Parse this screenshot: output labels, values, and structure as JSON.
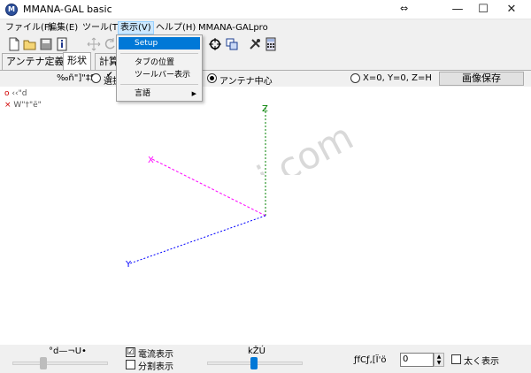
{
  "window": {
    "title": "MMANA-GAL basic",
    "app_icon_glyph": "M",
    "resize_glyph": "⇔",
    "minimize_glyph": "—",
    "maximize_glyph": "☐",
    "close_glyph": "✕"
  },
  "menubar": {
    "file": "ファイル(F)",
    "edit": "編集(E)",
    "tools": "ツール(T)",
    "view": "表示(V)",
    "help": "ヘルプ(H)",
    "pro": "MMANA-GALpro"
  },
  "view_menu": {
    "setup": "Setup",
    "tab_position": "タブの位置",
    "toolbar_show": "ツールバー表示",
    "toolbar_checked": "✔",
    "language": "言語",
    "submenu_arrow": "▶"
  },
  "toolbar": {
    "icons": [
      "new-file-icon",
      "open-folder-icon",
      "save-disk-icon",
      "info-icon",
      "move-icon",
      "rotate-icon",
      "target-icon",
      "copy-windows-icon",
      "tools-icon",
      "calculator-icon"
    ]
  },
  "tabs": {
    "antenna_def": "アンテナ定義",
    "shape": "形状",
    "calc": "計算"
  },
  "options": {
    "label_left": "‰ñ\"]\"‡S",
    "select_label": "選択",
    "antenna_center": "アンテナ中心",
    "origin_label": "X=0, Y=0, Z=H",
    "save_image": "画像保存"
  },
  "legend": {
    "line1_symbol": "o",
    "line1_text": "‹‹\"d",
    "line2_symbol": "×",
    "line2_text": "W\"†\"ë\""
  },
  "canvas": {
    "axis_z_label": "Z",
    "axis_x_label": "X",
    "axis_y_label": "Y",
    "watermark": "© jh4vaj.com",
    "colors": {
      "z_axis": "#008000",
      "x_axis": "#ff00ff",
      "y_axis": "#0000ff"
    }
  },
  "bottom": {
    "rotate_label": "°d—¬U•",
    "current_display": "電流表示",
    "current_checked": "☑",
    "split_display": "分割表示",
    "zoom_label": "kŽÚ",
    "spin_label": "ƒfCƒ‚[Ï'ö",
    "spin_value": "0",
    "bold_display": "太く表示"
  }
}
